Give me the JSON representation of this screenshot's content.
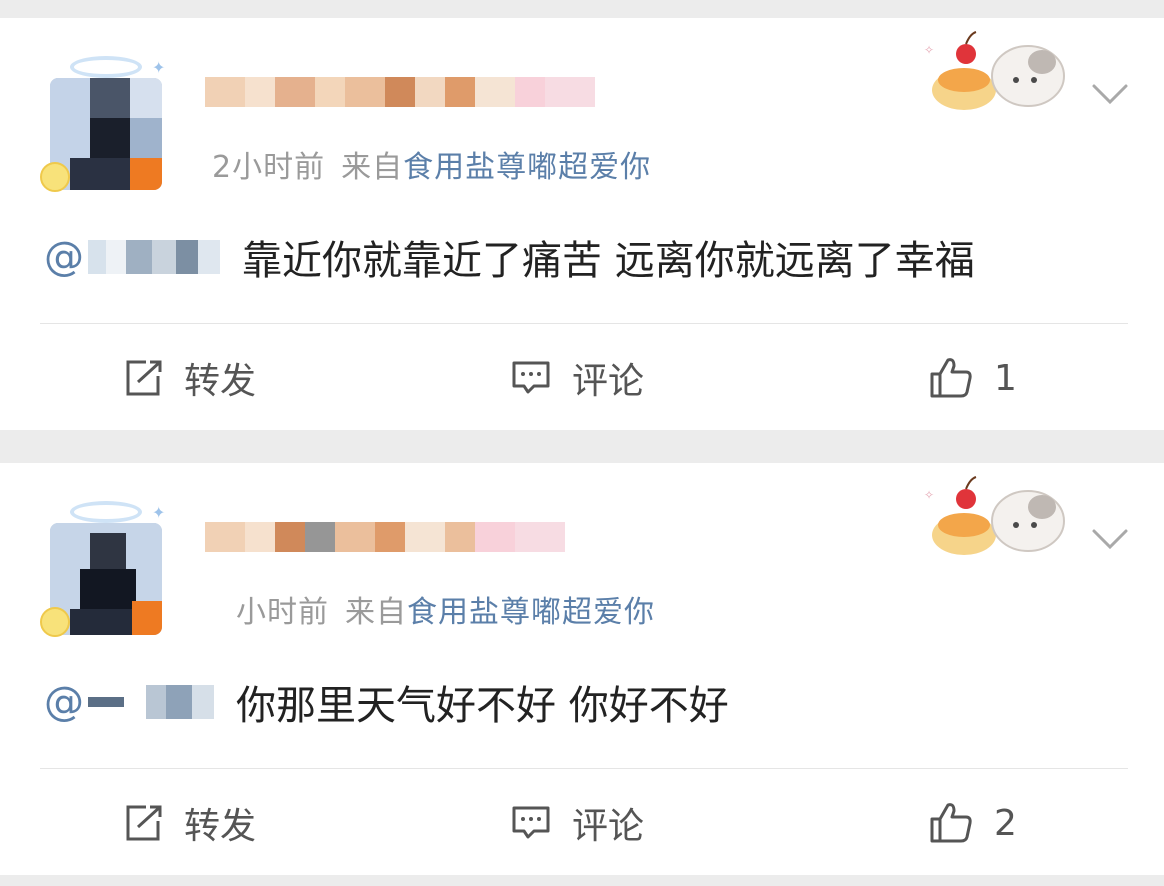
{
  "posts": [
    {
      "time": "2小时前",
      "from_label": "来自",
      "source": "食用盐尊嘟超爱你",
      "mention_prefix": "@",
      "text": "靠近你就靠近了痛苦 远离你就远离了幸福",
      "repost_label": "转发",
      "comment_label": "评论",
      "like_count": "1"
    },
    {
      "time": "小时前",
      "from_label": "来自",
      "source": "食用盐尊嘟超爱你",
      "mention_prefix": "@",
      "text": "你那里天气好不好 你好不好",
      "repost_label": "转发",
      "comment_label": "评论",
      "like_count": "2"
    }
  ],
  "icons": {
    "repost": "share-box-icon",
    "comment": "comment-bubble-icon",
    "like": "thumbs-up-icon",
    "more": "chevron-down-icon"
  },
  "colors": {
    "link": "#5b7fa9",
    "meta": "#9a9a9a",
    "text": "#222222",
    "background": "#ececec"
  }
}
